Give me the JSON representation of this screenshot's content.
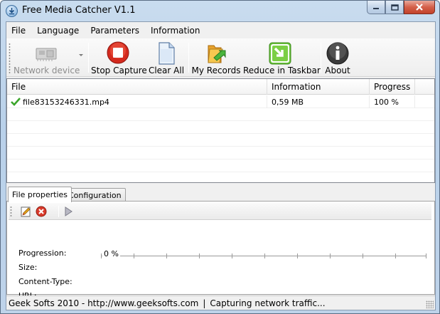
{
  "window": {
    "title": "Free Media Catcher V1.1",
    "controls": [
      "minimize",
      "maximize",
      "close"
    ]
  },
  "menu": {
    "items": [
      "File",
      "Language",
      "Parameters",
      "Information"
    ]
  },
  "toolbar": {
    "network_device": "Network device",
    "stop_capture": "Stop Capture",
    "clear_all": "Clear All",
    "my_records": "My Records",
    "reduce_in_taskbar": "Reduce in Taskbar",
    "about": "About"
  },
  "file_list": {
    "columns": [
      "File",
      "Information",
      "Progress"
    ],
    "rows": [
      {
        "file": "file83153246331.mp4",
        "information": "0,59 MB",
        "progress": "100 %",
        "status_icon": "check-icon"
      }
    ]
  },
  "tabs": {
    "items": [
      "File properties",
      "Configuration"
    ],
    "active": "File properties"
  },
  "file_properties": {
    "progression_label": "Progression:",
    "progression_value": "0 %",
    "size_label": "Size:",
    "content_type_label": "Content-Type:",
    "url_label": "URL:"
  },
  "statusbar": {
    "left": "Geek Softs 2010 - http://www.geeksofts.com",
    "divider": "|",
    "right": "Capturing network traffic..."
  },
  "icons": {
    "stop_capture": "stop-icon",
    "clear_all": "document-icon",
    "my_records": "folder-arrow-icon",
    "reduce_in_taskbar": "minimize-arrow-icon",
    "about": "info-icon",
    "network_device": "network-card-icon"
  },
  "colors": {
    "stop_red": "#d42a1e",
    "check_green": "#3aa52a",
    "tray_green": "#69c23a"
  }
}
